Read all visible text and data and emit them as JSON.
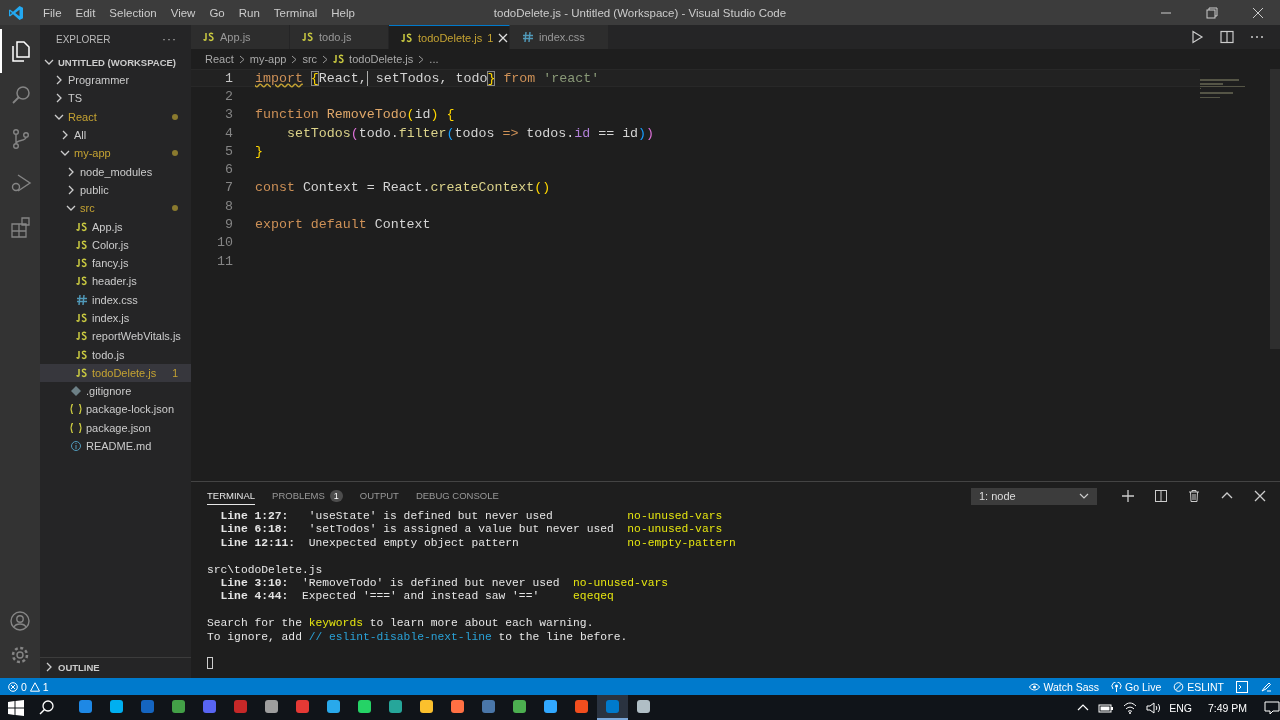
{
  "window": {
    "title": "todoDelete.js - Untitled (Workspace) - Visual Studio Code"
  },
  "menu": [
    "File",
    "Edit",
    "Selection",
    "View",
    "Go",
    "Run",
    "Terminal",
    "Help"
  ],
  "activity": [
    {
      "kind": "files",
      "selected": true
    },
    {
      "kind": "search",
      "selected": false
    },
    {
      "kind": "scm",
      "selected": false
    },
    {
      "kind": "debug",
      "selected": false
    },
    {
      "kind": "extensions",
      "selected": false
    }
  ],
  "sidebar": {
    "title": "EXPLORER",
    "more": "···",
    "workspace": "UNTITLED (WORKSPACE)",
    "outline": "OUTLINE",
    "tree": [
      {
        "label": "Programmer",
        "kind": "folder",
        "expanded": false,
        "modified": false,
        "selected": false
      },
      {
        "label": "TS",
        "kind": "folder",
        "expanded": false,
        "modified": false,
        "selected": false
      },
      {
        "label": "React",
        "kind": "folder",
        "expanded": true,
        "modified": true,
        "selected": false,
        "children": [
          {
            "label": "All",
            "kind": "folder",
            "expanded": false,
            "modified": false,
            "selected": false
          },
          {
            "label": "my-app",
            "kind": "folder",
            "expanded": true,
            "modified": true,
            "selected": false,
            "children": [
              {
                "label": "node_modules",
                "kind": "folder",
                "expanded": false,
                "modified": false,
                "selected": false
              },
              {
                "label": "public",
                "kind": "folder",
                "expanded": false,
                "modified": false,
                "selected": false
              },
              {
                "label": "src",
                "kind": "folder",
                "expanded": true,
                "modified": true,
                "selected": false,
                "children": [
                  {
                    "label": "App.js",
                    "kind": "js",
                    "modified": false,
                    "selected": false
                  },
                  {
                    "label": "Color.js",
                    "kind": "js",
                    "modified": false,
                    "selected": false
                  },
                  {
                    "label": "fancy.js",
                    "kind": "js",
                    "modified": false,
                    "selected": false
                  },
                  {
                    "label": "header.js",
                    "kind": "js",
                    "modified": false,
                    "selected": false
                  },
                  {
                    "label": "index.css",
                    "kind": "css",
                    "modified": false,
                    "selected": false
                  },
                  {
                    "label": "index.js",
                    "kind": "js",
                    "modified": false,
                    "selected": false
                  },
                  {
                    "label": "reportWebVitals.js",
                    "kind": "js",
                    "modified": false,
                    "selected": false
                  },
                  {
                    "label": "todo.js",
                    "kind": "js",
                    "modified": false,
                    "selected": false
                  },
                  {
                    "label": "todoDelete.js",
                    "kind": "js",
                    "modified": true,
                    "selected": true,
                    "errors": "1"
                  }
                ]
              },
              {
                "label": ".gitignore",
                "kind": "git",
                "modified": false,
                "selected": false
              },
              {
                "label": "package-lock.json",
                "kind": "json",
                "modified": false,
                "selected": false
              },
              {
                "label": "package.json",
                "kind": "json",
                "modified": false,
                "selected": false
              },
              {
                "label": "README.md",
                "kind": "info",
                "modified": false,
                "selected": false
              }
            ]
          }
        ]
      }
    ]
  },
  "tabs": [
    {
      "label": "App.js",
      "kind": "js",
      "selected": false
    },
    {
      "label": "todo.js",
      "kind": "js",
      "selected": false
    },
    {
      "label": "todoDelete.js",
      "kind": "js",
      "selected": true,
      "errors": "1"
    },
    {
      "label": "index.css",
      "kind": "css",
      "selected": false
    }
  ],
  "breadcrumb": [
    "React",
    "my-app",
    "src",
    "todoDelete.js",
    "..."
  ],
  "code": [
    {
      "number": "1",
      "current": true,
      "tokens": [
        {
          "kind": "kw-warn",
          "text": "import"
        },
        {
          "kind": "match",
          "text": "{",
          "space_before": true
        },
        {
          "kind": "plain",
          "text": "React,"
        },
        {
          "kind": "cursor",
          "text": " setTodos, todo"
        },
        {
          "kind": "match",
          "text": "}"
        },
        {
          "kind": "kw",
          "text": "from",
          "space_before": true
        },
        {
          "kind": "string",
          "text": "'react'",
          "space_before": true
        }
      ]
    },
    {
      "number": "2",
      "current": false
    },
    {
      "number": "3",
      "current": false,
      "tokens": [
        {
          "kind": "kw",
          "text": "function"
        },
        {
          "kind": "fn",
          "text": "RemoveTodo",
          "space_before": true
        },
        {
          "kind": "paren1",
          "text": "("
        },
        {
          "kind": "plain",
          "text": "id"
        },
        {
          "kind": "paren1",
          "text": ")"
        },
        {
          "kind": "paren1",
          "text": "{",
          "space_before": true
        }
      ]
    },
    {
      "number": "4",
      "current": false,
      "tokens": [
        {
          "kind": "fn2",
          "text": "    setTodos"
        },
        {
          "kind": "paren2",
          "text": "("
        },
        {
          "kind": "plain",
          "text": "todo."
        },
        {
          "kind": "fn2",
          "text": "filter"
        },
        {
          "kind": "paren3",
          "text": "("
        },
        {
          "kind": "plain",
          "text": "todos "
        },
        {
          "kind": "op",
          "text": "=>"
        },
        {
          "kind": "plain",
          "text": " todos."
        },
        {
          "kind": "prop",
          "text": "id"
        },
        {
          "kind": "plain",
          "text": " == id"
        },
        {
          "kind": "paren3",
          "text": ")"
        },
        {
          "kind": "paren2",
          "text": ")"
        }
      ]
    },
    {
      "number": "5",
      "current": false,
      "tokens": [
        {
          "kind": "paren1",
          "text": "}"
        }
      ]
    },
    {
      "number": "6",
      "current": false
    },
    {
      "number": "7",
      "current": false,
      "tokens": [
        {
          "kind": "kw",
          "text": "const"
        },
        {
          "kind": "plain",
          "text": " Context = React."
        },
        {
          "kind": "fn2",
          "text": "createContext"
        },
        {
          "kind": "paren1",
          "text": "()"
        }
      ]
    },
    {
      "number": "8",
      "current": false
    },
    {
      "number": "9",
      "current": false,
      "tokens": [
        {
          "kind": "kw",
          "text": "export"
        },
        {
          "kind": "kw",
          "text": "default",
          "space_before": true
        },
        {
          "kind": "plain",
          "text": " Context"
        }
      ]
    },
    {
      "number": "10",
      "current": false
    },
    {
      "number": "11",
      "current": false
    }
  ],
  "panel": {
    "tabs": [
      {
        "label": "TERMINAL",
        "selected": true
      },
      {
        "label": "PROBLEMS",
        "selected": false,
        "count": "1"
      },
      {
        "label": "OUTPUT",
        "selected": false
      },
      {
        "label": "DEBUG CONSOLE",
        "selected": false
      }
    ],
    "terminal_select": "1: node",
    "groups": [
      [
        [
          {
            "kind": "bold",
            "text": "  Line 1:27:  "
          },
          {
            "kind": "plain",
            "text": " 'useState' is defined but never used           "
          },
          {
            "kind": "rule",
            "text": "no-unused-vars"
          }
        ],
        [
          {
            "kind": "bold",
            "text": "  Line 6:18:  "
          },
          {
            "kind": "plain",
            "text": " 'setTodos' is assigned a value but never used  "
          },
          {
            "kind": "rule",
            "text": "no-unused-vars"
          }
        ],
        [
          {
            "kind": "bold",
            "text": "  Line 12:11: "
          },
          {
            "kind": "plain",
            "text": " Unexpected empty object pattern                "
          },
          {
            "kind": "rule",
            "text": "no-empty-pattern"
          }
        ]
      ],
      [
        [
          {
            "kind": "plain",
            "text": "src\\todoDelete.js"
          }
        ],
        [
          {
            "kind": "bold",
            "text": "  Line 3:10: "
          },
          {
            "kind": "plain",
            "text": " 'RemoveTodo' is defined but never used  "
          },
          {
            "kind": "rule",
            "text": "no-unused-vars"
          }
        ],
        [
          {
            "kind": "bold",
            "text": "  Line 4:44: "
          },
          {
            "kind": "plain",
            "text": " Expected '===' and instead saw '=='     "
          },
          {
            "kind": "rule",
            "text": "eqeqeq"
          }
        ]
      ],
      [
        [
          {
            "kind": "plain",
            "text": "Search for the "
          },
          {
            "kind": "rule",
            "text": "keywords"
          },
          {
            "kind": "plain",
            "text": " to learn more about each warning."
          }
        ],
        [
          {
            "kind": "plain",
            "text": "To ignore, add "
          },
          {
            "kind": "link",
            "text": "// eslint-disable-next-line"
          },
          {
            "kind": "plain",
            "text": " to the line before."
          }
        ]
      ]
    ]
  },
  "status": {
    "errors": "0",
    "warnings": "1",
    "right": [
      {
        "kind": "eye",
        "text": "Watch Sass"
      },
      {
        "kind": "radio",
        "text": "Go Live"
      },
      {
        "kind": "ban",
        "text": "ESLINT"
      }
    ]
  },
  "taskbar": {
    "apps": [
      {
        "color": "#1e88e5",
        "selected": false
      },
      {
        "color": "#00aff0",
        "selected": false
      },
      {
        "color": "#1565c0",
        "selected": false
      },
      {
        "color": "#43a047",
        "selected": false
      },
      {
        "color": "#5865f2",
        "selected": false
      },
      {
        "color": "#c62828",
        "selected": false
      },
      {
        "color": "#9e9e9e",
        "selected": false
      },
      {
        "color": "#e53935",
        "selected": false
      },
      {
        "color": "#29a9eb",
        "selected": false
      },
      {
        "color": "#25d366",
        "selected": false
      },
      {
        "color": "#26a69a",
        "selected": false
      },
      {
        "color": "#fbc02d",
        "selected": false
      },
      {
        "color": "#ff7043",
        "selected": false
      },
      {
        "color": "#4a76a8",
        "selected": false
      },
      {
        "color": "#4caf50",
        "selected": false
      },
      {
        "color": "#31a8ff",
        "selected": false
      },
      {
        "color": "#f24e1e",
        "selected": false
      },
      {
        "color": "#007acc",
        "selected": true
      },
      {
        "color": "#b0bec5",
        "selected": false
      }
    ],
    "lang": "ENG",
    "time": "7:49 PM"
  }
}
